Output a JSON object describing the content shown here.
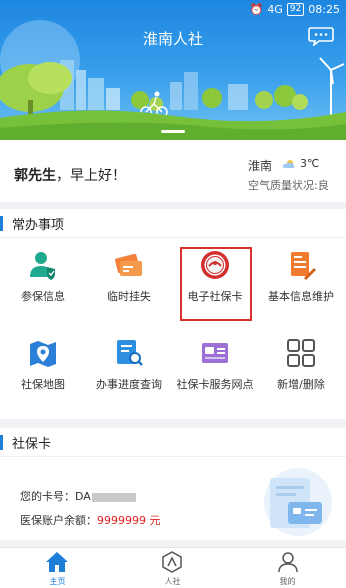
{
  "status_bar": {
    "signal": "4G",
    "battery": "92",
    "time": "08:25"
  },
  "header": {
    "title": "淮南人社"
  },
  "greeting": {
    "surname": "郭",
    "honorific": "先生",
    "message": "，早上好！",
    "city": "淮南",
    "temperature": "3℃",
    "air_quality": "空气质量状况:良"
  },
  "services": {
    "section_title": "常办事项",
    "items": [
      {
        "label": "参保信息",
        "icon": "user-shield-icon"
      },
      {
        "label": "临时挂失",
        "icon": "card-lock-icon"
      },
      {
        "label": "电子社保卡",
        "icon": "social-security-badge-icon"
      },
      {
        "label": "基本信息维护",
        "icon": "document-edit-icon"
      },
      {
        "label": "社保地图",
        "icon": "map-pin-icon"
      },
      {
        "label": "办事进度查询",
        "icon": "progress-search-icon"
      },
      {
        "label": "社保卡服务网点",
        "icon": "service-outlet-icon"
      },
      {
        "label": "新增/删除",
        "icon": "grid-icon"
      }
    ]
  },
  "card_section": {
    "section_title": "社保卡",
    "card_number_label": "您的卡号：",
    "card_number_prefix": "DA",
    "balance_label": "医保账户余额：",
    "balance_value": "9999999 元"
  },
  "tabbar": {
    "items": [
      {
        "label": "主页",
        "active": true
      },
      {
        "label": "人社",
        "active": false
      },
      {
        "label": "我的",
        "active": false
      }
    ]
  },
  "colors": {
    "primary": "#1d7fd8",
    "highlight": "#d9312b",
    "balance": "#e02020"
  }
}
